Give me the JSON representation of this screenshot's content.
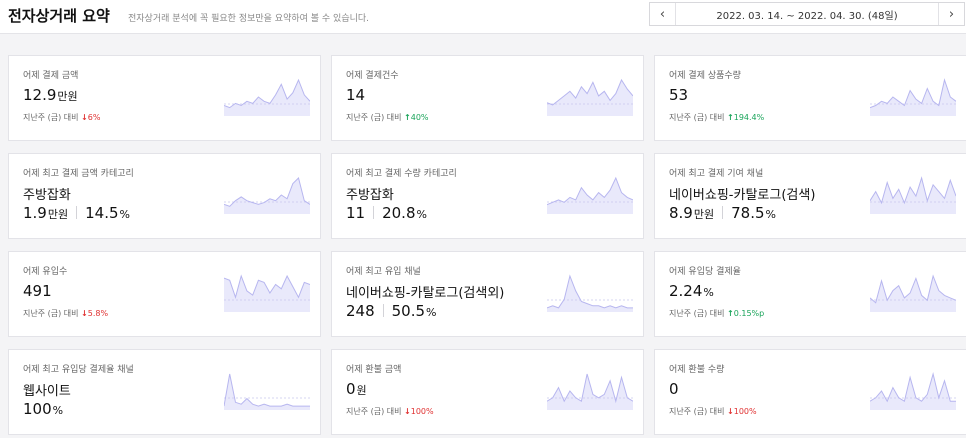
{
  "header": {
    "title": "전자상거래 요약",
    "subtitle": "전자상거래 분석에 꼭 필요한 정보만을 요약하여 볼 수 있습니다.",
    "date_range": "2022. 03. 14. ~ 2022. 04. 30. (48일)",
    "prev_icon": "chevron-left-icon",
    "next_icon": "chevron-right-icon"
  },
  "cards": [
    {
      "label": "어제 결제 금액",
      "value": "12.9",
      "unit": "만원",
      "compare_label": "지난주 (금) 대비",
      "direction": "down",
      "change": "6%",
      "spark": [
        4,
        3,
        5,
        4,
        6,
        5,
        8,
        6,
        5,
        9,
        14,
        7,
        10,
        16,
        9,
        6
      ]
    },
    {
      "label": "어제 결제건수",
      "value": "14",
      "unit": "",
      "compare_label": "지난주 (금) 대비",
      "direction": "up",
      "change": "40%",
      "spark": [
        5,
        4,
        6,
        8,
        10,
        7,
        12,
        9,
        14,
        8,
        10,
        6,
        9,
        15,
        11,
        8
      ]
    },
    {
      "label": "어제 결제 상품수량",
      "value": "53",
      "unit": "",
      "compare_label": "지난주 (금) 대비",
      "direction": "up",
      "change": "194.4%",
      "spark": [
        3,
        4,
        6,
        5,
        8,
        6,
        4,
        11,
        7,
        5,
        12,
        6,
        4,
        16,
        8,
        6
      ]
    },
    {
      "label": "어제 최고 결제 금액 카테고리",
      "sub": "주방잡화",
      "value": "1.9",
      "unit": "만원",
      "value2": "14.5",
      "unit2": "%",
      "spark": [
        4,
        3,
        6,
        8,
        6,
        5,
        4,
        5,
        7,
        6,
        9,
        7,
        15,
        18,
        6,
        4
      ]
    },
    {
      "label": "어제 최고 결제 수량 카테고리",
      "sub": "주방잡화",
      "value": "11",
      "unit": "",
      "value2": "20.8",
      "unit2": "%",
      "spark": [
        3,
        4,
        5,
        4,
        6,
        5,
        10,
        7,
        5,
        8,
        6,
        9,
        14,
        8,
        6,
        5
      ]
    },
    {
      "label": "어제 최고 결제 기여 채널",
      "sub": "네이버쇼핑-카탈로그(검색)",
      "value": "8.9",
      "unit": "만원",
      "value2": "78.5",
      "unit2": "%",
      "spark": [
        5,
        9,
        4,
        13,
        6,
        10,
        4,
        11,
        7,
        15,
        5,
        12,
        9,
        6,
        14,
        7
      ]
    },
    {
      "label": "어제 유입수",
      "value": "491",
      "unit": "",
      "compare_label": "지난주 (금) 대비",
      "direction": "down",
      "change": "5.8%",
      "spark": [
        15,
        14,
        6,
        16,
        9,
        7,
        14,
        13,
        8,
        12,
        10,
        16,
        11,
        6,
        13,
        12
      ]
    },
    {
      "label": "어제 최고 유입 채널",
      "sub": "네이버쇼핑-카탈로그(검색외)",
      "value": "248",
      "unit": "",
      "value2": "50.5",
      "unit2": "%",
      "spark": [
        1,
        2,
        1,
        5,
        16,
        9,
        4,
        3,
        2,
        2,
        1,
        2,
        1,
        2,
        1,
        1
      ]
    },
    {
      "label": "어제 유입당 결제율",
      "value": "2.24",
      "unit": "%",
      "compare_label": "지난주 (금) 대비",
      "direction": "up",
      "change": "0.15%p",
      "spark": [
        5,
        3,
        12,
        4,
        8,
        10,
        5,
        7,
        13,
        6,
        4,
        14,
        8,
        6,
        5,
        4
      ]
    },
    {
      "label": "어제 최고 유입당 결제율 채널",
      "sub": "웹사이트",
      "value": "100",
      "unit": "%",
      "spark": [
        1,
        18,
        3,
        2,
        5,
        2,
        1,
        2,
        1,
        1,
        1,
        2,
        1,
        1,
        1,
        1
      ]
    },
    {
      "label": "어제 환불 금액",
      "value": "0",
      "unit": "원",
      "compare_label": "지난주 (금) 대비",
      "direction": "down",
      "change": "100%",
      "spark": [
        2,
        3,
        6,
        2,
        5,
        3,
        2,
        10,
        4,
        3,
        4,
        8,
        2,
        9,
        3,
        2
      ]
    },
    {
      "label": "어제 환불 수량",
      "value": "0",
      "unit": "",
      "compare_label": "지난주 (금) 대비",
      "direction": "down",
      "change": "100%",
      "spark": [
        2,
        3,
        5,
        2,
        6,
        3,
        2,
        9,
        3,
        2,
        4,
        10,
        3,
        8,
        2,
        2
      ]
    }
  ]
}
